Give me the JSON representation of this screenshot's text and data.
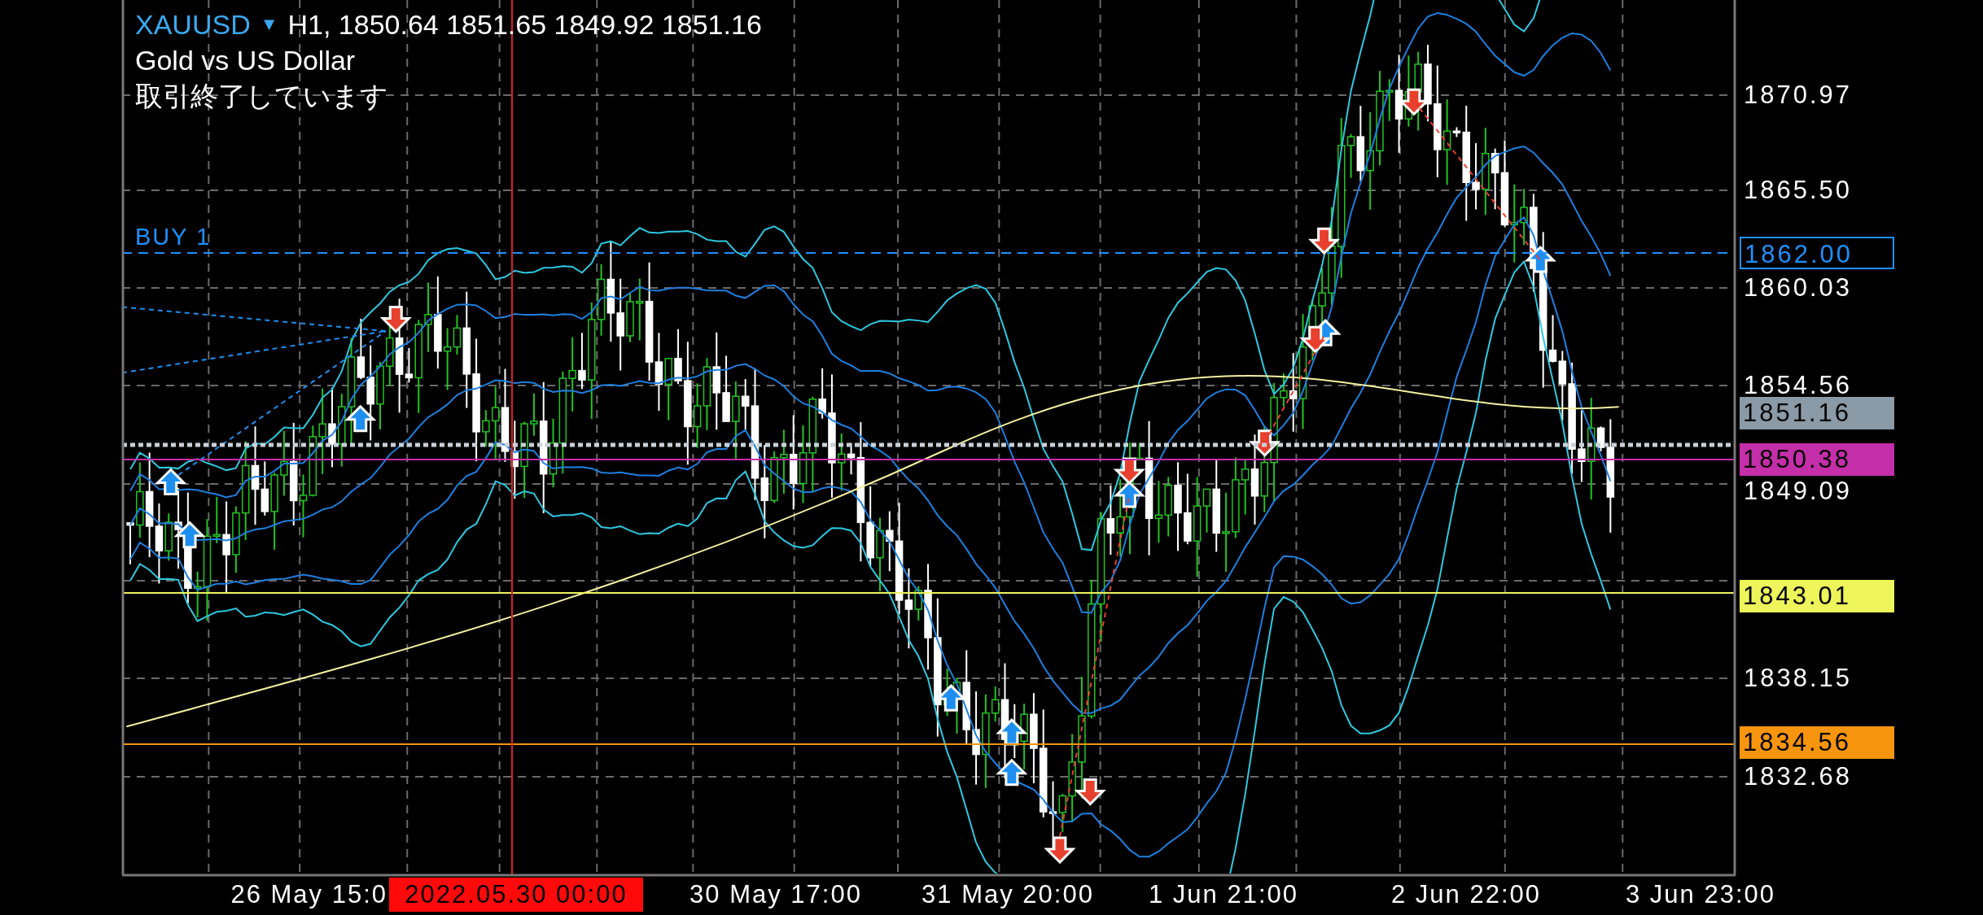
{
  "header": {
    "symbol": "XAUUSD",
    "symbol_caret": "▼",
    "quote": "H1, 1850.64 1851.65 1849.92 1851.16",
    "description": "Gold vs US Dollar",
    "status": "取引終了しています"
  },
  "order_line": {
    "label": "BUY 1"
  },
  "price_axis": [
    "1870.97",
    "1865.50",
    "1860.03",
    "1854.56",
    "1849.09",
    "1838.15",
    "1832.68"
  ],
  "price_tags": [
    {
      "label": "1862.00",
      "kind": "outline",
      "color": "#1e90ff"
    },
    {
      "label": "1851.16",
      "kind": "fill",
      "color": "#8a9aa6"
    },
    {
      "label": "1850.38",
      "kind": "fill",
      "color": "#c42ea8"
    },
    {
      "label": "1843.01",
      "kind": "fill",
      "color": "#eef55a"
    },
    {
      "label": "1834.56",
      "kind": "fill",
      "color": "#f7950f"
    }
  ],
  "time_axis": [
    "26 May 15:0",
    "30 May 17:00",
    "31 May 20:00",
    "1 Jun 21:00",
    "2 Jun 22:00",
    "3 Jun 23:00"
  ],
  "crosshair_time": "2022.05.30 00:00"
}
